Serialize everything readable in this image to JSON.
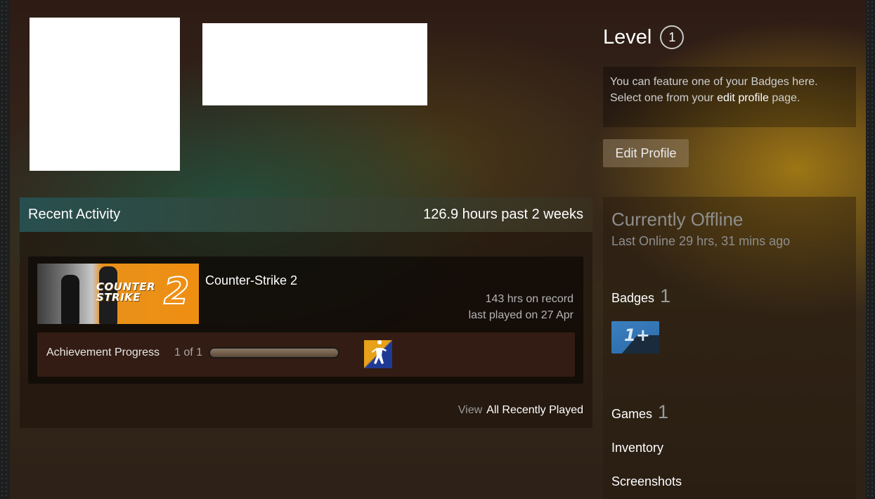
{
  "profile": {
    "level_label": "Level",
    "level_value": "1",
    "feature_text_1": "You can feature one of your Badges here.",
    "feature_text_2a": "Select one from your ",
    "feature_link": "edit profile",
    "feature_text_2b": " page.",
    "edit_button": "Edit Profile"
  },
  "recent_activity": {
    "title": "Recent Activity",
    "hours_summary": "126.9 hours past 2 weeks",
    "game": {
      "name": "Counter-Strike 2",
      "capsule_text": "COUNTER STRIKE",
      "capsule_number": "2",
      "hours_on_record": "143 hrs on record",
      "last_played": "last played on 27 Apr",
      "achievement_label": "Achievement Progress",
      "achievement_count": "1 of 1",
      "achievement_fraction": 1.0
    },
    "view_label": "View",
    "view_link": "All Recently Played"
  },
  "sidebar": {
    "status": "Currently Offline",
    "last_online": "Last Online 29 hrs, 31 mins ago",
    "badges_label": "Badges",
    "badges_count": "1",
    "badge_icon_text": "1+",
    "games_label": "Games",
    "games_count": "1",
    "inventory_label": "Inventory",
    "screenshots_label": "Screenshots"
  },
  "colors": {
    "accent_orange": "#ef8f12",
    "badge_blue": "#3b7fbf"
  }
}
